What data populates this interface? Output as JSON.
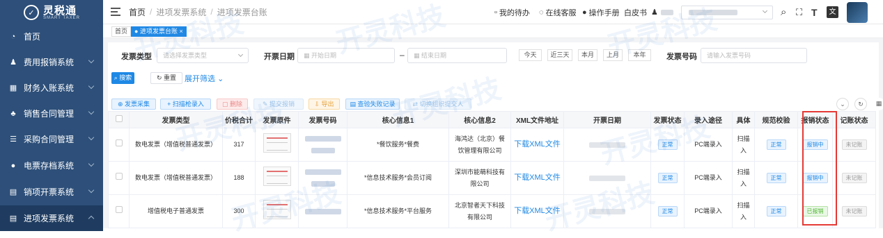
{
  "app": {
    "logo_main": "灵税通",
    "logo_sub": "SMART TAXER"
  },
  "sidebar": {
    "items": [
      {
        "label": "首页",
        "icon": "dashboard-icon"
      },
      {
        "label": "费用报销系统",
        "icon": "user-icon"
      },
      {
        "label": "财务入账系统",
        "icon": "grid-icon"
      },
      {
        "label": "销售合同管理",
        "icon": "tree-icon"
      },
      {
        "label": "采购合同管理",
        "icon": "list-icon"
      },
      {
        "label": "电票存档系统",
        "icon": "circle-icon"
      },
      {
        "label": "销项开票系统",
        "icon": "doc-icon"
      },
      {
        "label": "进项发票系统",
        "icon": "doc-icon"
      }
    ]
  },
  "header": {
    "breadcrumb": [
      "首页",
      "进项发票系统",
      "进项发票台账"
    ],
    "todo": "我的待办",
    "service": "在线客服",
    "manual": "操作手册",
    "skin": "白皮书"
  },
  "tabs": [
    {
      "label": "首页"
    },
    {
      "label": "进项发票台账"
    }
  ],
  "filters": {
    "type_label": "发票类型",
    "type_placeholder": "请选择发票类型",
    "date_label": "开票日期",
    "start_placeholder": "开始日期",
    "end_placeholder": "结束日期",
    "date_sep": "–",
    "quick": [
      "今天",
      "近三天",
      "本月",
      "上月",
      "本年"
    ],
    "no_label": "发票号码",
    "no_placeholder": "请输入发票号码",
    "search": "搜索",
    "reset": "重置",
    "expand": "展开筛选"
  },
  "actions": [
    "发票采集",
    "扫描枪录入",
    "删除",
    "提交报销",
    "导出",
    "查验失败记录",
    "切换组织提交人"
  ],
  "table": {
    "headers": [
      "发票类型",
      "价税合计",
      "发票原件",
      "发票号码",
      "核心信息1",
      "核心信息2",
      "XML文件地址",
      "开票日期",
      "发票状态",
      "录入途径",
      "具体",
      "规范校验",
      "报销状态",
      "记账状态"
    ],
    "rows": [
      {
        "type": "数电发票（增值税普通发票）",
        "total": "317",
        "info1": "*餐饮服务*餐费",
        "info2": "海鸿达（北京）餐饮管理有限公司",
        "xml": "下载XML文件",
        "status": "正常",
        "entry": "PC端录入",
        "detail": "扫描入",
        "check": "正常",
        "reim": "报销中",
        "acct": "未记账"
      },
      {
        "type": "数电发票（增值税普通发票）",
        "total": "188",
        "info1": "*信息技术服务*会员订阅",
        "info2": "深圳市能萌科技有限公司",
        "xml": "下载XML文件",
        "status": "正常",
        "entry": "PC端录入",
        "detail": "扫描入",
        "check": "正常",
        "reim": "报销中",
        "acct": "未记账"
      },
      {
        "type": "增值税电子普通发票",
        "total": "300",
        "info1": "*信息技术服务*平台服务",
        "info2": "北京智者天下科技有限公司",
        "xml": "下载XML文件",
        "status": "正常",
        "entry": "PC端录入",
        "detail": "扫描入",
        "check": "正常",
        "reim": "已报销",
        "acct": "未记账"
      }
    ]
  },
  "colors": {
    "sidebar": "#2d4f79",
    "primary": "#1e88e5",
    "highlight": "#e53935",
    "success": "#52b735"
  },
  "watermark": "开灵科技"
}
